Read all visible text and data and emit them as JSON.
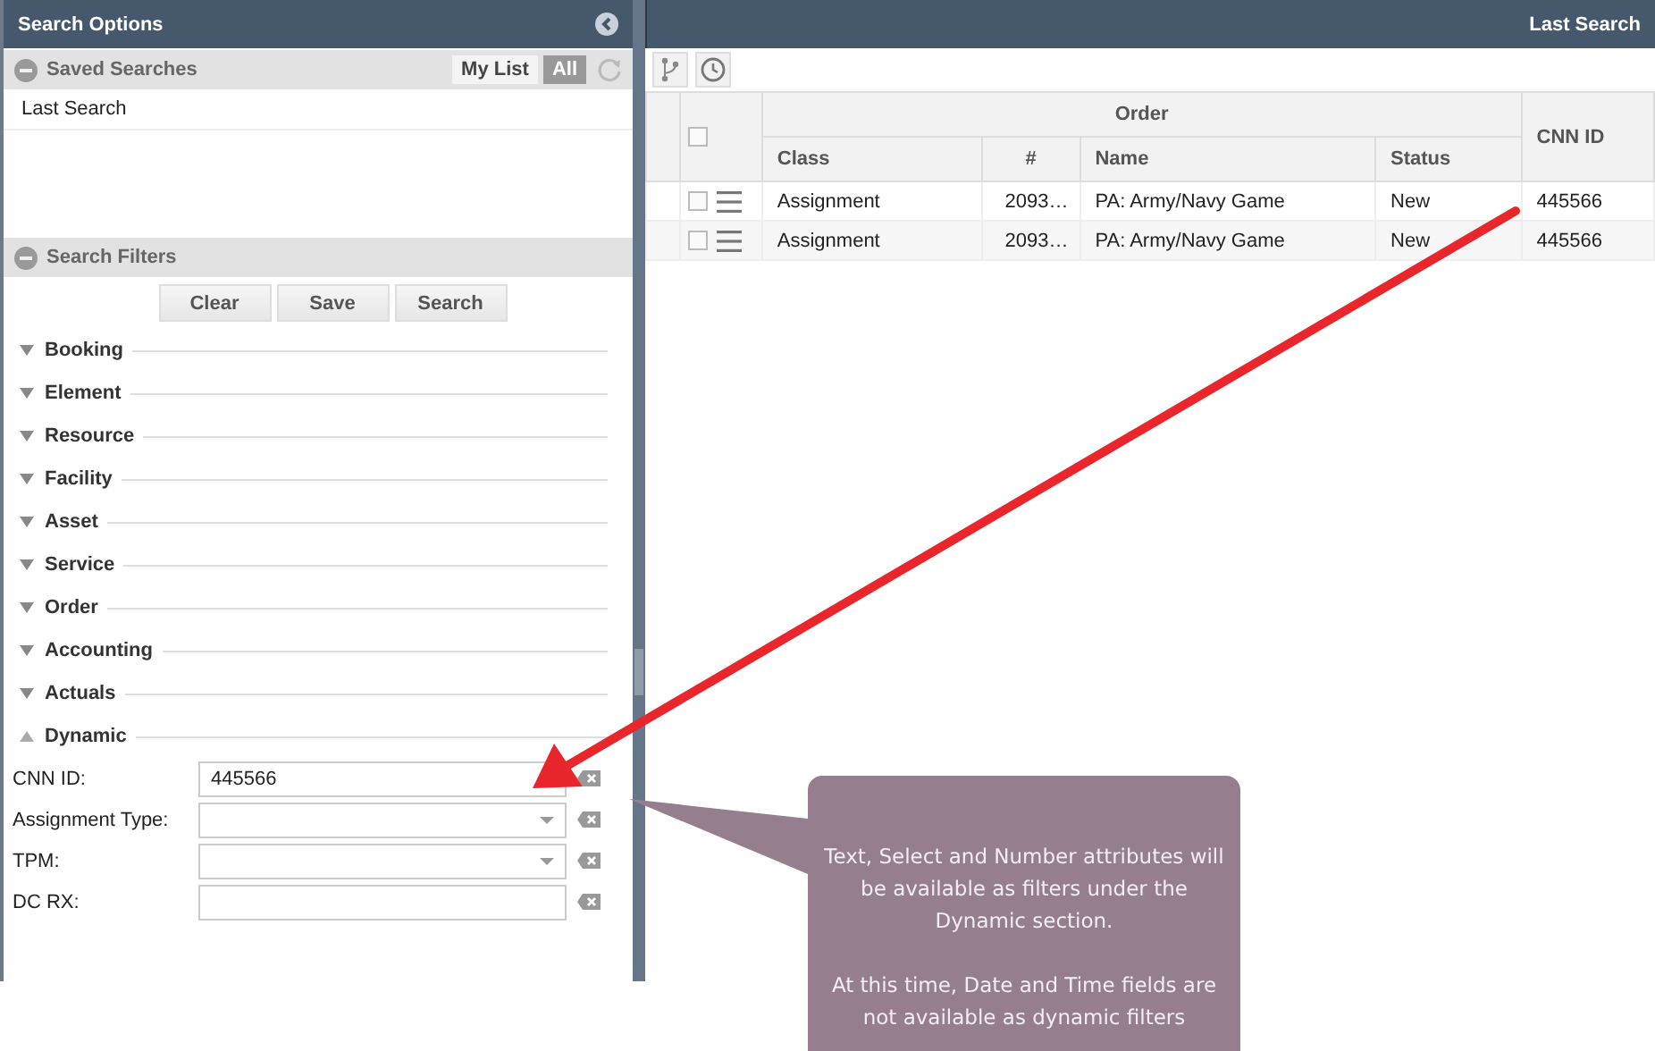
{
  "search_options": {
    "title": "Search Options",
    "saved_searches": {
      "title": "Saved Searches",
      "expanded": true,
      "toggles": [
        {
          "label": "My List",
          "selected": false
        },
        {
          "label": "All",
          "selected": true
        }
      ],
      "items": [
        "Last Search"
      ]
    },
    "search_filters": {
      "title": "Search Filters",
      "expanded": true,
      "buttons": [
        "Clear",
        "Save",
        "Search"
      ],
      "sections": [
        {
          "label": "Booking",
          "expanded": false
        },
        {
          "label": "Element",
          "expanded": false
        },
        {
          "label": "Resource",
          "expanded": false
        },
        {
          "label": "Facility",
          "expanded": false
        },
        {
          "label": "Asset",
          "expanded": false
        },
        {
          "label": "Service",
          "expanded": false
        },
        {
          "label": "Order",
          "expanded": false
        },
        {
          "label": "Accounting",
          "expanded": false
        },
        {
          "label": "Actuals",
          "expanded": false
        },
        {
          "label": "Dynamic",
          "expanded": true
        }
      ],
      "fields": [
        {
          "label": "CNN ID:",
          "kind": "text",
          "value": "445566"
        },
        {
          "label": "Assignment Type:",
          "kind": "select"
        },
        {
          "label": "TPM:",
          "kind": "select"
        },
        {
          "label": "DC RX:",
          "kind": "text"
        }
      ]
    }
  },
  "results": {
    "title": "Last Search",
    "all_checked": false,
    "group": "Order",
    "columns": [
      "Class",
      "#",
      "Name",
      "Status",
      "CNN ID"
    ],
    "rows": [
      {
        "checked": false,
        "cells": [
          "Assignment",
          "2093…",
          "PA: Army/Navy Game",
          "New",
          "445566"
        ]
      },
      {
        "checked": false,
        "cells": [
          "Assignment",
          "2093…",
          "PA: Army/Navy Game",
          "New",
          "445566"
        ]
      }
    ]
  },
  "callout": {
    "paragraphs": [
      "Text, Select and Number attributes will be available as filters under the Dynamic section.",
      "At this time, Date and Time fields are not available as dynamic filters"
    ]
  }
}
